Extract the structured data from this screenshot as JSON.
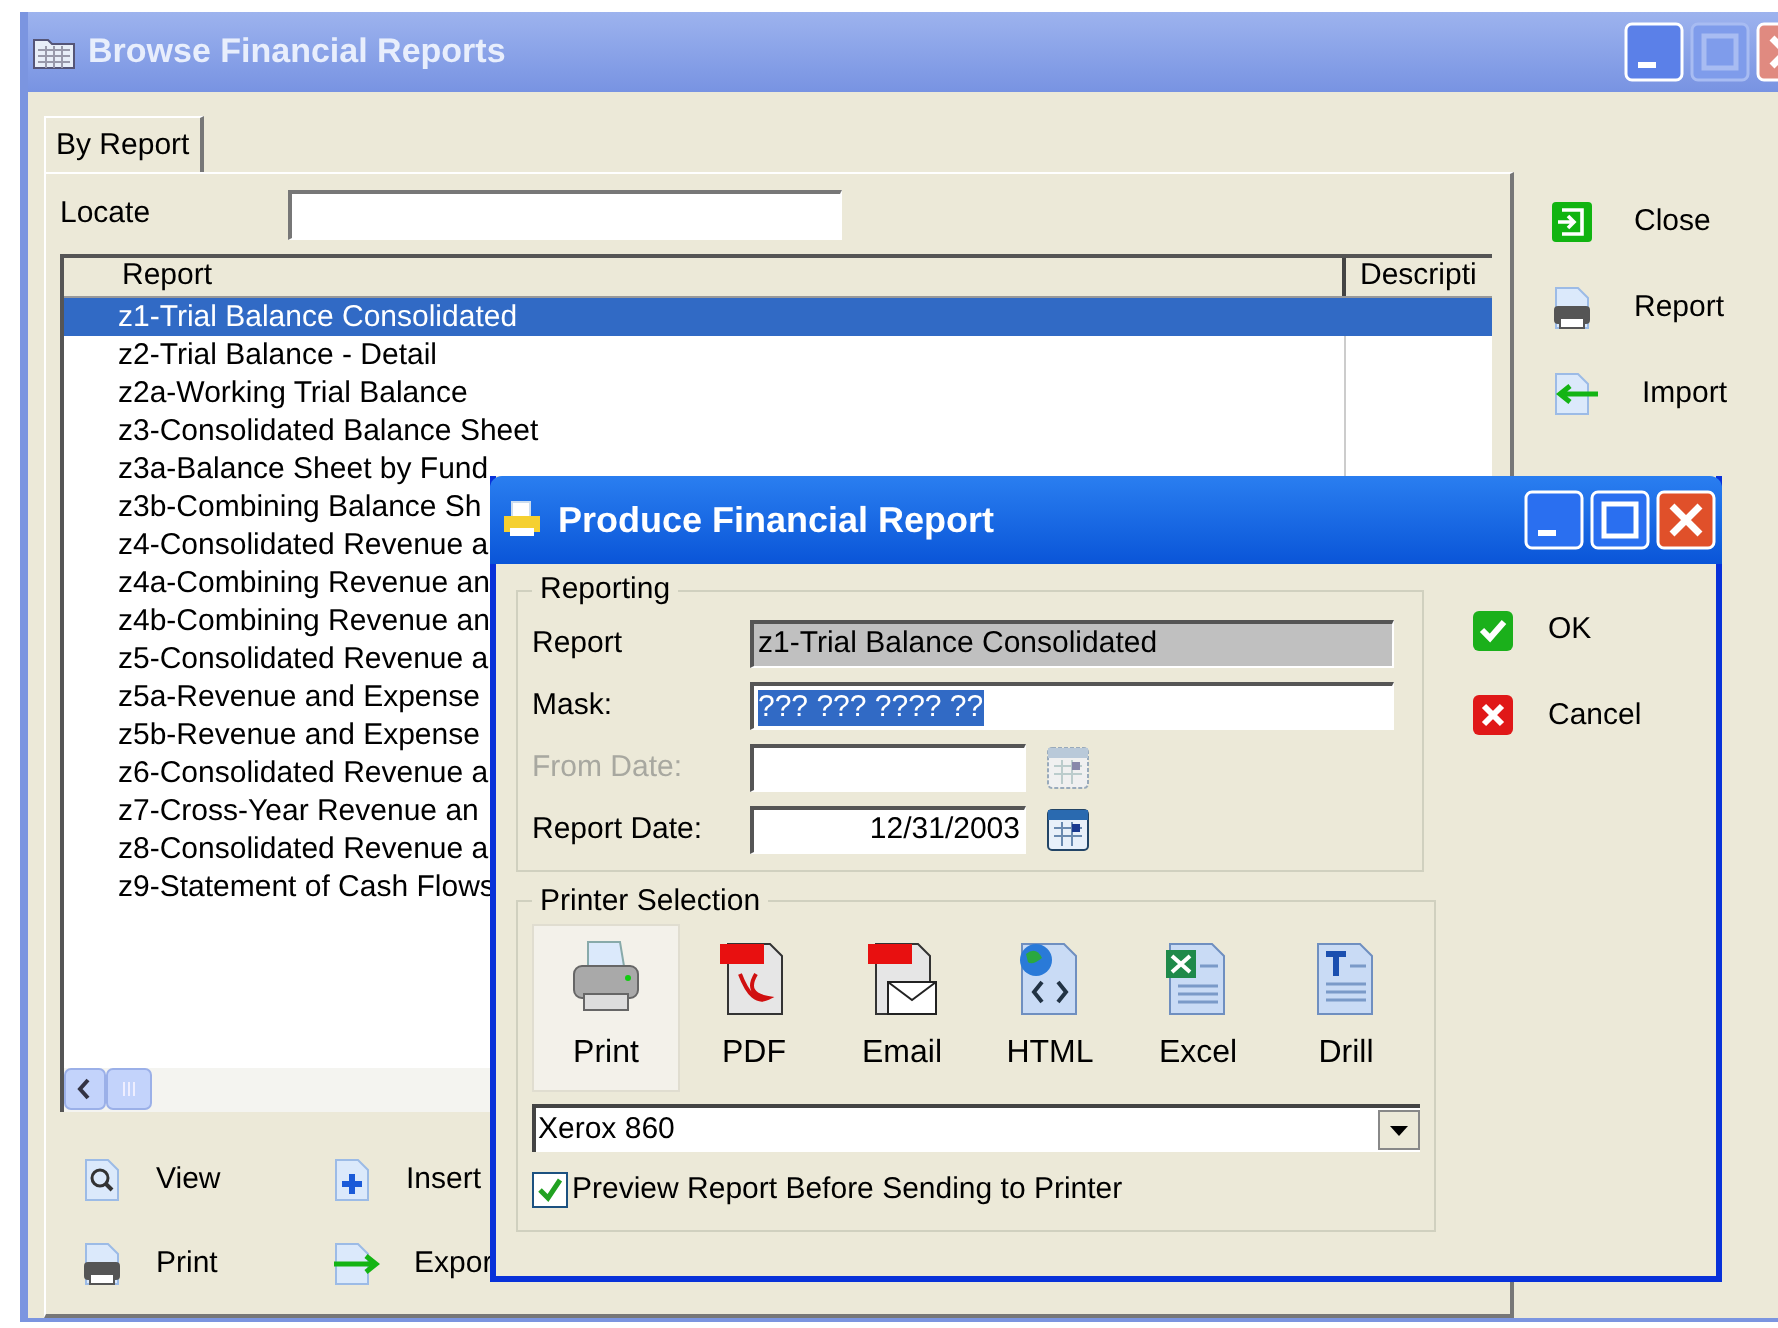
{
  "window": {
    "title": "Browse Financial Reports"
  },
  "tabs": [
    {
      "label": "By Report",
      "selected": true
    }
  ],
  "locate": {
    "label": "Locate"
  },
  "table": {
    "columns": [
      "Report",
      "Descripti"
    ],
    "rows": [
      {
        "report": "z1-Trial Balance Consolidated",
        "selected": true
      },
      {
        "report": "z2-Trial Balance - Detail",
        "selected": false
      },
      {
        "report": "z2a-Working Trial Balance",
        "selected": false
      },
      {
        "report": "z3-Consolidated Balance Sheet",
        "selected": false
      },
      {
        "report": "z3a-Balance Sheet by Fund",
        "selected": false
      },
      {
        "report": "z3b-Combining Balance Sh",
        "selected": false
      },
      {
        "report": "z4-Consolidated Revenue a",
        "selected": false
      },
      {
        "report": "z4a-Combining Revenue an",
        "selected": false
      },
      {
        "report": "z4b-Combining Revenue an",
        "selected": false
      },
      {
        "report": "z5-Consolidated Revenue a",
        "selected": false
      },
      {
        "report": "z5a-Revenue and Expense",
        "selected": false
      },
      {
        "report": "z5b-Revenue and Expense",
        "selected": false
      },
      {
        "report": "z6-Consolidated Revenue a",
        "selected": false
      },
      {
        "report": "z7-Cross-Year Revenue an",
        "selected": false
      },
      {
        "report": "z8-Consolidated Revenue a",
        "selected": false
      },
      {
        "report": "z9-Statement of Cash Flows",
        "selected": false
      }
    ]
  },
  "side_buttons": [
    "Close",
    "Report",
    "Import"
  ],
  "bottom_buttons": [
    "View",
    "Insert",
    "Print",
    "Expor"
  ],
  "dialog": {
    "title": "Produce Financial Report",
    "reporting": {
      "legend": "Reporting",
      "fields": [
        {
          "label": "Report",
          "value": "z1-Trial Balance Consolidated",
          "kind": "readonly",
          "disabled": false
        },
        {
          "label": "Mask:",
          "value": "??? ??? ???? ??",
          "kind": "text",
          "disabled": false
        },
        {
          "label": "From Date:",
          "kind": "date",
          "disabled": true
        },
        {
          "label": "Report Date:",
          "value": "12/31/2003",
          "kind": "date",
          "disabled": false
        }
      ]
    },
    "buttons": [
      "OK",
      "Cancel"
    ],
    "printer_selection": {
      "legend": "Printer Selection",
      "outputs": [
        {
          "label": "Print",
          "selected": true
        },
        {
          "label": "PDF",
          "selected": false
        },
        {
          "label": "Email",
          "selected": false
        },
        {
          "label": "HTML",
          "selected": false
        },
        {
          "label": "Excel",
          "selected": false
        },
        {
          "label": "Drill",
          "selected": false
        }
      ],
      "printer": "Xerox 860",
      "preview": {
        "label": "Preview Report Before Sending to Printer",
        "checked": true
      }
    }
  }
}
